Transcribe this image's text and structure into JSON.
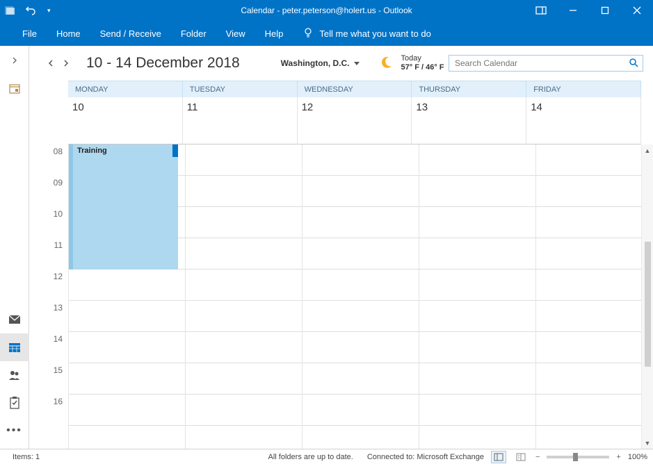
{
  "titlebar": {
    "title": "Calendar - peter.peterson@holert.us  -  Outlook"
  },
  "ribbon": {
    "file": "File",
    "home": "Home",
    "sendreceive": "Send / Receive",
    "folder": "Folder",
    "view": "View",
    "help": "Help",
    "tellme": "Tell me what you want to do"
  },
  "header": {
    "date_range": "10 - 14 December 2018",
    "location": "Washington,  D.C.",
    "weather_today": "Today",
    "weather_temp": "57° F / 46° F",
    "search_placeholder": "Search Calendar"
  },
  "days": {
    "d0": {
      "name": "MONDAY",
      "num": "10"
    },
    "d1": {
      "name": "TUESDAY",
      "num": "11"
    },
    "d2": {
      "name": "WEDNESDAY",
      "num": "12"
    },
    "d3": {
      "name": "THURSDAY",
      "num": "13"
    },
    "d4": {
      "name": "FRIDAY",
      "num": "14"
    }
  },
  "hours": {
    "h0": "08",
    "h1": "09",
    "h2": "10",
    "h3": "11",
    "h4": "12",
    "h5": "13",
    "h6": "14",
    "h7": "15",
    "h8": "16"
  },
  "event": {
    "title": "Training"
  },
  "status": {
    "items": "Items: 1",
    "folders": "All folders are up to date.",
    "connected": "Connected to: Microsoft Exchange",
    "zoom": "100%"
  }
}
